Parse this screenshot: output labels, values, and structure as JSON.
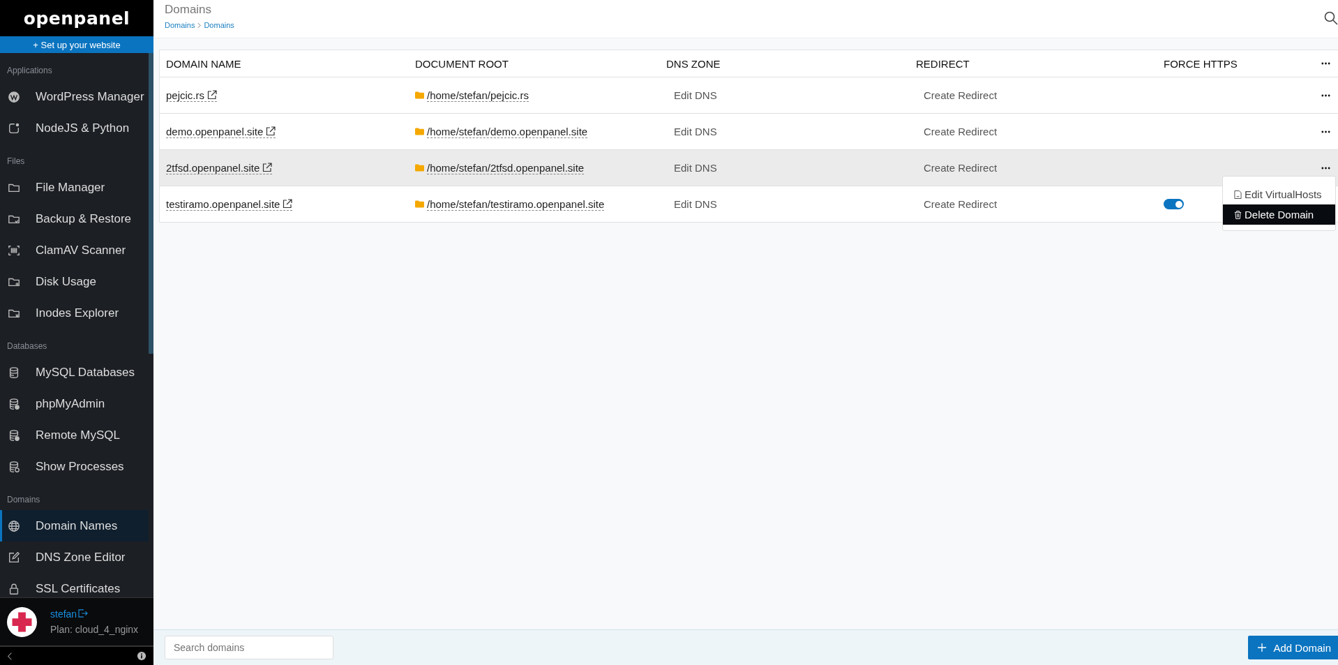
{
  "brand": {
    "logo": "openpanel",
    "setup_button": "+ Set up your website"
  },
  "sidebar": {
    "sections": [
      {
        "title": "Applications",
        "items": [
          {
            "label": "WordPress Manager",
            "selected": false
          },
          {
            "label": "NodeJS & Python",
            "selected": false
          }
        ]
      },
      {
        "title": "Files",
        "items": [
          {
            "label": "File Manager",
            "selected": false
          },
          {
            "label": "Backup & Restore",
            "selected": false
          },
          {
            "label": "ClamAV Scanner",
            "selected": false
          },
          {
            "label": "Disk Usage",
            "selected": false
          },
          {
            "label": "Inodes Explorer",
            "selected": false
          }
        ]
      },
      {
        "title": "Databases",
        "items": [
          {
            "label": "MySQL Databases",
            "selected": false
          },
          {
            "label": "phpMyAdmin",
            "selected": false
          },
          {
            "label": "Remote MySQL",
            "selected": false
          },
          {
            "label": "Show Processes",
            "selected": false
          }
        ]
      },
      {
        "title": "Domains",
        "items": [
          {
            "label": "Domain Names",
            "selected": true
          },
          {
            "label": "DNS Zone Editor",
            "selected": false
          },
          {
            "label": "SSL Certificates",
            "selected": false
          }
        ]
      }
    ]
  },
  "user": {
    "name": "stefan",
    "plan": "Plan: cloud_4_nginx"
  },
  "header": {
    "title": "Domains",
    "breadcrumb": [
      "Domains",
      "Domains"
    ]
  },
  "table": {
    "columns": [
      "DOMAIN NAME",
      "DOCUMENT ROOT",
      "DNS ZONE",
      "REDIRECT",
      "FORCE HTTPS"
    ],
    "rows": [
      {
        "domain": "pejcic.rs",
        "root": "/home/stefan/pejcic.rs",
        "dns": "Edit DNS",
        "redirect": "Create Redirect",
        "highlighted": false
      },
      {
        "domain": "demo.openpanel.site",
        "root": "/home/stefan/demo.openpanel.site",
        "dns": "Edit DNS",
        "redirect": "Create Redirect",
        "highlighted": false
      },
      {
        "domain": "2tfsd.openpanel.site",
        "root": "/home/stefan/2tfsd.openpanel.site",
        "dns": "Edit DNS",
        "redirect": "Create Redirect",
        "highlighted": true
      },
      {
        "domain": "testiramo.openpanel.site",
        "root": "/home/stefan/testiramo.openpanel.site",
        "dns": "Edit DNS",
        "redirect": "Create Redirect",
        "highlighted": false,
        "force_https": true
      }
    ]
  },
  "row_menu": {
    "open": true,
    "items": [
      {
        "label": "Edit VirtualHosts",
        "selected": false
      },
      {
        "label": "Delete Domain",
        "selected": true
      }
    ]
  },
  "footer": {
    "search": {
      "placeholder": "Search domains"
    },
    "add_button": "Add Domain"
  }
}
